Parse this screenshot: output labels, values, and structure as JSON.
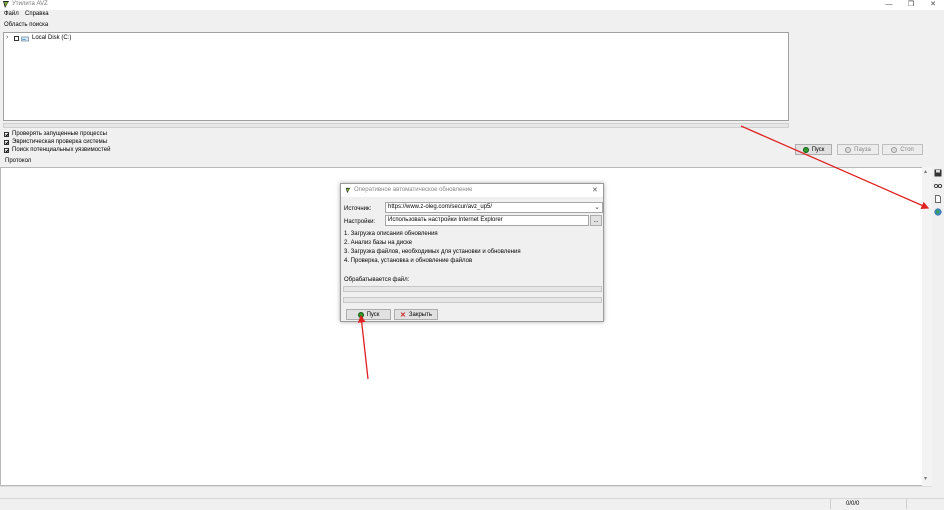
{
  "window": {
    "title": "Утилита AVZ",
    "controls": {
      "minimize": "—",
      "maximize": "❐",
      "close": "✕"
    }
  },
  "menu": {
    "items": [
      "Файл",
      "Справка"
    ]
  },
  "search_area": {
    "label": "Область поиска",
    "tree": [
      {
        "label": "Local Disk (C:)",
        "expand": "›"
      }
    ]
  },
  "options": {
    "checkboxes": [
      {
        "label": "Проверять запущенные процессы",
        "checked": true
      },
      {
        "label": "Эвристическая проверка системы",
        "checked": true
      },
      {
        "label": "Поиск потенциальных уязвимостей",
        "checked": true
      }
    ]
  },
  "scan_buttons": {
    "start": "Пуск",
    "pause": "Пауза",
    "stop": "Стоп"
  },
  "protocol": {
    "label": "Протокол"
  },
  "status": {
    "counter": "0/0/0"
  },
  "dialog": {
    "title": "Оперативное автоматическое обновление",
    "close": "✕",
    "source_label": "Источник:",
    "source_value": "https://www.z-oleg.com/secur/avz_up5/",
    "settings_label": "Настройки:",
    "settings_value": "Использовать настройки Internet Explorer",
    "settings_browse": "...",
    "steps": [
      "1. Загрузка описания обновления",
      "2. Анализ базы на диске",
      "3. Загрузка файлов, необходимых для установки и обновления",
      "4. Проверка, установка и обновление файлов"
    ],
    "processing_label": "Обрабатывается файл:",
    "start_button": "Пуск",
    "close_button": "Закрыть"
  },
  "colors": {
    "annotation_arrow": "#e02020",
    "play_green": "#2a9d2a",
    "close_red": "#cc2222",
    "panel_bg": "#f0f0f0"
  }
}
